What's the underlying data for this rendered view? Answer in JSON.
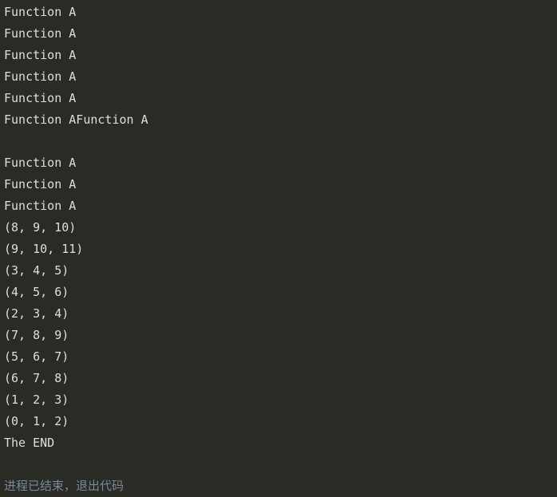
{
  "console": {
    "background_color": "#2b2b26",
    "text_color": "#dedede",
    "exit_text_color": "#7a8798",
    "font_size_px": 15,
    "line_height_px": 27,
    "lines": [
      {
        "text": "Function A",
        "kind": "output"
      },
      {
        "text": "Function A",
        "kind": "output"
      },
      {
        "text": "Function A",
        "kind": "output"
      },
      {
        "text": "Function A",
        "kind": "output"
      },
      {
        "text": "Function A",
        "kind": "output"
      },
      {
        "text": "Function AFunction A",
        "kind": "output"
      },
      {
        "text": "",
        "kind": "blank"
      },
      {
        "text": "Function A",
        "kind": "output"
      },
      {
        "text": "Function A",
        "kind": "output"
      },
      {
        "text": "Function A",
        "kind": "output"
      },
      {
        "text": "(8, 9, 10)",
        "kind": "output"
      },
      {
        "text": "(9, 10, 11)",
        "kind": "output"
      },
      {
        "text": "(3, 4, 5)",
        "kind": "output"
      },
      {
        "text": "(4, 5, 6)",
        "kind": "output"
      },
      {
        "text": "(2, 3, 4)",
        "kind": "output"
      },
      {
        "text": "(7, 8, 9)",
        "kind": "output"
      },
      {
        "text": "(5, 6, 7)",
        "kind": "output"
      },
      {
        "text": "(6, 7, 8)",
        "kind": "output"
      },
      {
        "text": "(1, 2, 3)",
        "kind": "output"
      },
      {
        "text": "(0, 1, 2)",
        "kind": "output"
      },
      {
        "text": "The END",
        "kind": "output"
      },
      {
        "text": "",
        "kind": "blank"
      },
      {
        "text": "进程已结束，退出代码",
        "kind": "exit"
      }
    ]
  }
}
